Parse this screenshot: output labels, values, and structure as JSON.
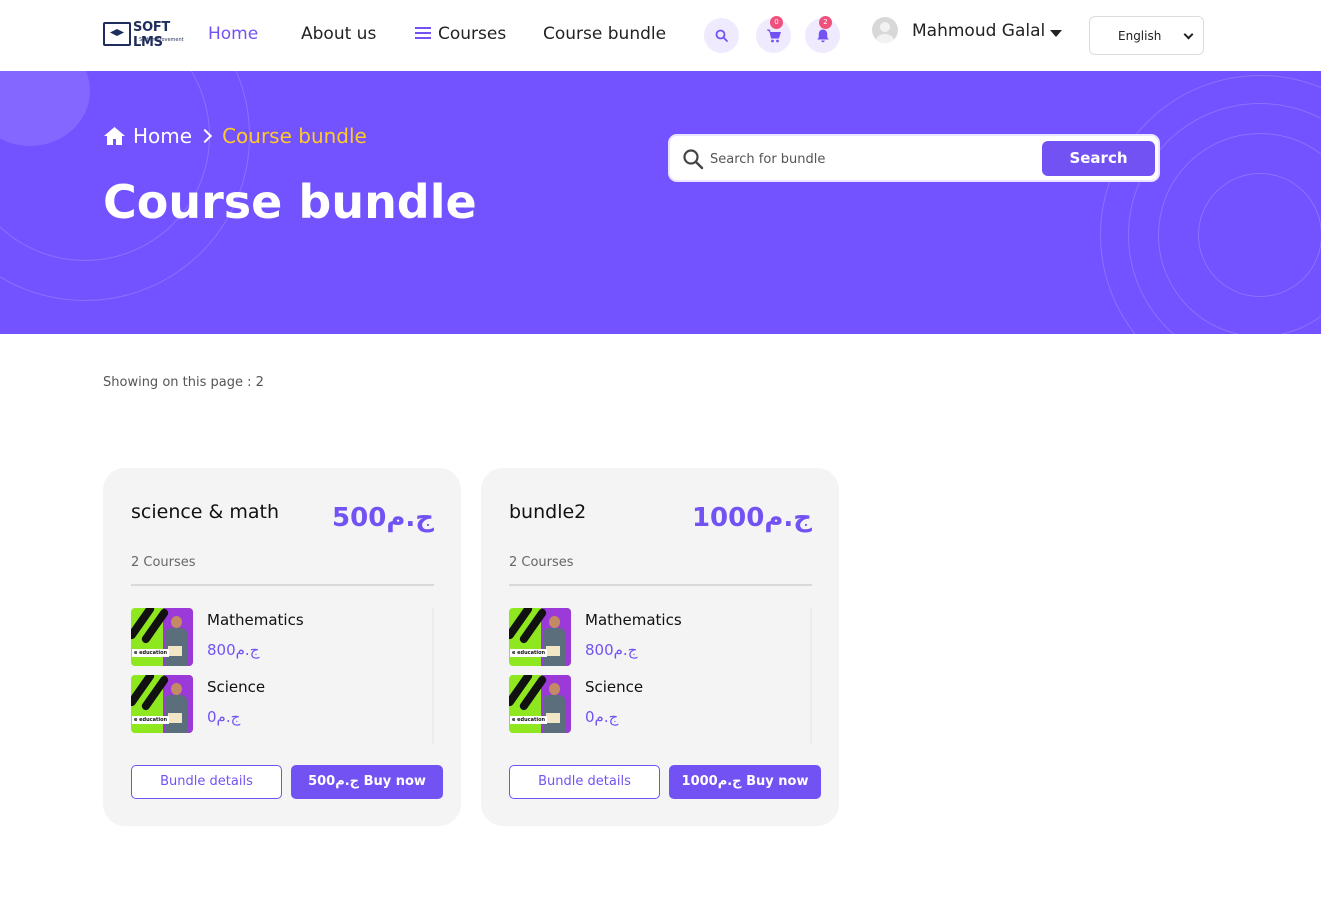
{
  "header": {
    "logo_text": "SOFT LMS",
    "logo_tagline": "Self Improvement",
    "nav": {
      "home": "Home",
      "about": "About us",
      "courses": "Courses",
      "bundle": "Course bundle"
    },
    "cart_count": "0",
    "notification_count": "2",
    "user_name": "Mahmoud Galal",
    "language": "English"
  },
  "hero": {
    "breadcrumb_home": "Home",
    "breadcrumb_current": "Course bundle",
    "title": "Course bundle",
    "search_placeholder": "Search for bundle",
    "search_button": "Search"
  },
  "showing": "Showing on this page : 2",
  "bundles": [
    {
      "title": "science & math",
      "price": "500ج.م",
      "course_count": "2 Courses",
      "courses": [
        {
          "name": "Mathematics",
          "price": "800ج.م",
          "thumb_label": "e education"
        },
        {
          "name": "Science",
          "price": "0ج.م",
          "thumb_label": "e education"
        }
      ],
      "details_label": "Bundle details",
      "buy_label": "500ج.م Buy now"
    },
    {
      "title": "bundle2",
      "price": "1000ج.م",
      "course_count": "2 Courses",
      "courses": [
        {
          "name": "Mathematics",
          "price": "800ج.م",
          "thumb_label": "e education"
        },
        {
          "name": "Science",
          "price": "0ج.م",
          "thumb_label": "e education"
        }
      ],
      "details_label": "Bundle details",
      "buy_label": "1000ج.م Buy now"
    }
  ],
  "colors": {
    "accent": "#7352f4",
    "hero_bg": "#7352ff",
    "breadcrumb_current": "#ffc928",
    "badge": "#f0507c"
  }
}
